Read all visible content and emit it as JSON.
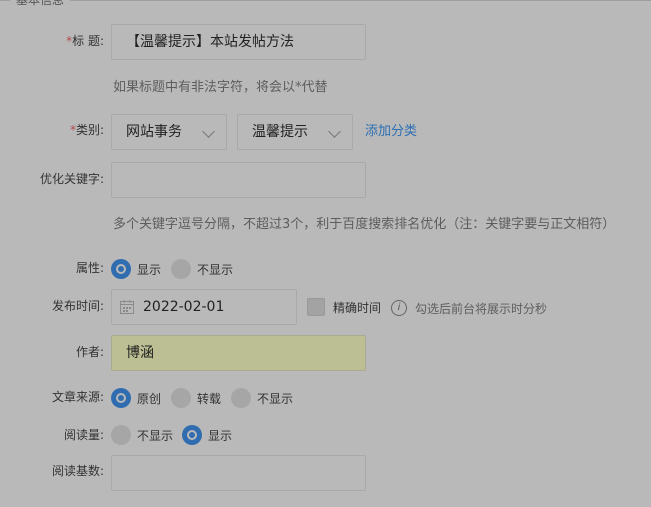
{
  "section": {
    "legend": "基本信息"
  },
  "title_row": {
    "label_req": "*",
    "label": "标 题:",
    "value": "【温馨提示】本站发帖方法",
    "hint": "如果标题中有非法字符，将会以*代替"
  },
  "category_row": {
    "label_req": "*",
    "label": "类别:",
    "select1": "网站事务",
    "select2": "温馨提示",
    "add_link": "添加分类"
  },
  "keywords_row": {
    "label": "优化关键字:",
    "value": "",
    "hint": "多个关键字逗号分隔，不超过3个，利于百度搜索排名优化（注：关键字要与正文相符）"
  },
  "attribute_row": {
    "label": "属性:",
    "options": [
      "显示",
      "不显示"
    ],
    "selected": "显示"
  },
  "publish_row": {
    "label": "发布时间:",
    "date": "2022-02-01",
    "precise_label": "精确时间",
    "info_icon": "i",
    "hint": "勾选后前台将展示时分秒"
  },
  "author_row": {
    "label": "作者:",
    "value": "博涵",
    "highlight": "#bcbf93"
  },
  "source_row": {
    "label": "文章来源:",
    "options": [
      "原创",
      "转载",
      "不显示"
    ],
    "selected": "原创"
  },
  "reads_row": {
    "label": "阅读量:",
    "options": [
      "不显示",
      "显示"
    ],
    "selected": "显示"
  },
  "base_reads_row": {
    "label": "阅读基数:",
    "value": ""
  },
  "colors": {
    "accent": "#2f6db0",
    "link": "#2c6fb5",
    "required": "#b34a4a"
  }
}
